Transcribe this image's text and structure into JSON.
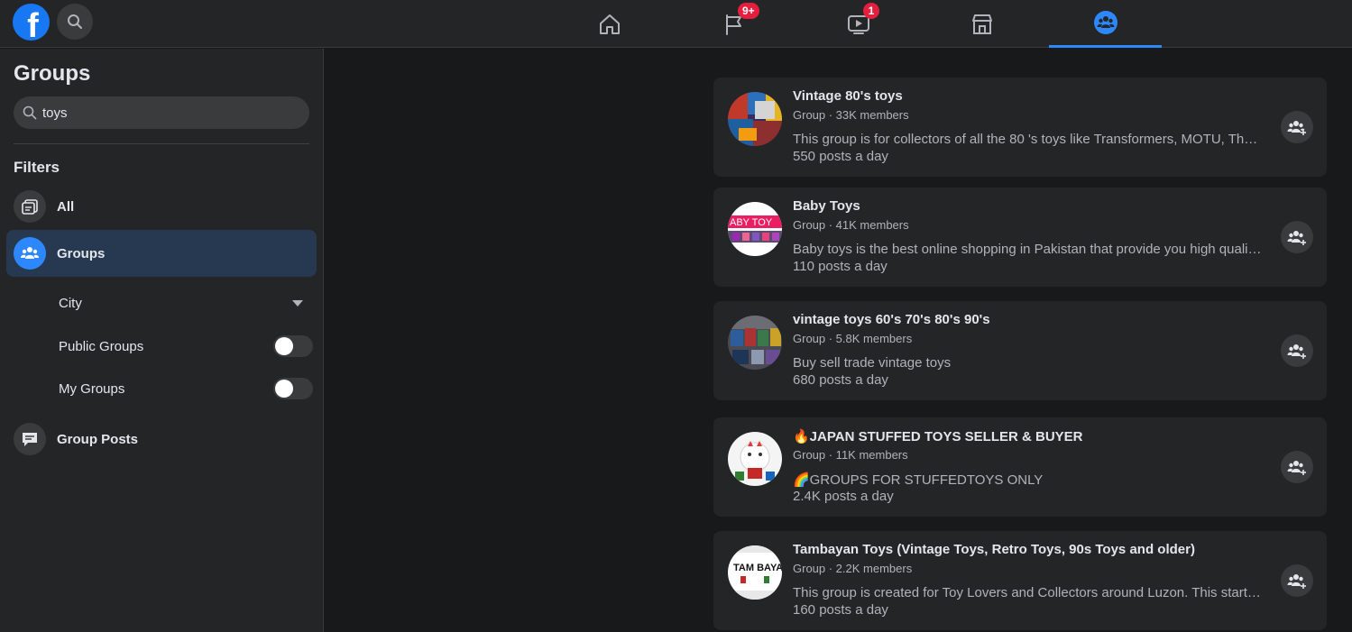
{
  "topbar": {
    "logo_letter": "f",
    "watch_badge": "1",
    "pages_badge": "9+"
  },
  "sidebar": {
    "title": "Groups",
    "search_value": "toys",
    "filters_heading": "Filters",
    "items": [
      {
        "label": "All"
      },
      {
        "label": "Groups"
      },
      {
        "label": "Group Posts"
      }
    ],
    "sub_filters": [
      {
        "label": "City"
      },
      {
        "label": "Public Groups"
      },
      {
        "label": "My Groups"
      }
    ]
  },
  "results": [
    {
      "title": "Vintage 80's toys",
      "meta": "Group · 33K members",
      "description": "This group is for collectors of all the 80 's toys like Transformers, MOTU, Thundercats, G.I. Joe and more",
      "posts": "550 posts a day"
    },
    {
      "title": "Baby Toys",
      "meta": "Group · 41K members",
      "description": "Baby toys is the best online shopping in Pakistan that provide you high quality baby products",
      "posts": "110 posts a day"
    },
    {
      "title": "vintage toys 60's 70's 80's 90's",
      "meta": "Group · 5.8K members",
      "description": "Buy sell trade vintage toys",
      "posts": "680 posts a day"
    },
    {
      "title": "🔥JAPAN STUFFED TOYS SELLER & BUYER",
      "meta": "Group · 11K members",
      "description": "🌈GROUPS FOR STUFFEDTOYS ONLY",
      "posts": "2.4K posts a day"
    },
    {
      "title": "Tambayan Toys (Vintage Toys, Retro Toys, 90s Toys and older)",
      "meta": "Group · 2.2K members",
      "description": "This group is created for Toy Lovers and Collectors around Luzon. This started as a small group",
      "posts": "160 posts a day",
      "avatar_text": "TAM BAYAN"
    }
  ]
}
